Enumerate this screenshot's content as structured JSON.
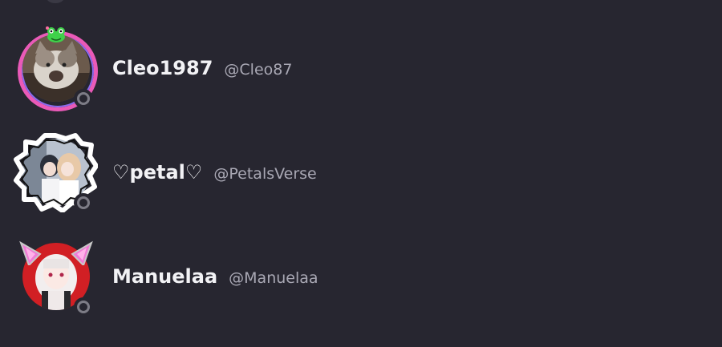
{
  "colors": {
    "background": "#272630",
    "name_text": "#f2f2f5",
    "handle_text": "#a9a8b4",
    "status_offline": "#7d7c86",
    "ring_accent": "#ea5ab8"
  },
  "members": [
    {
      "display_name": "Cleo1987",
      "handle": "@Cleo87",
      "status": "offline",
      "avatar_icon": "cat-avatar-icon",
      "decoration": "pink-ring-frog"
    },
    {
      "display_name": "♡petal♡",
      "handle": "@PetalsVerse",
      "status": "offline",
      "avatar_icon": "anime-couple-avatar-icon",
      "decoration": "white-jagged-frame"
    },
    {
      "display_name": "Manuelaa",
      "handle": "@Manuelaa",
      "status": "offline",
      "avatar_icon": "anime-girl-avatar-icon",
      "decoration": "cat-ears"
    }
  ]
}
